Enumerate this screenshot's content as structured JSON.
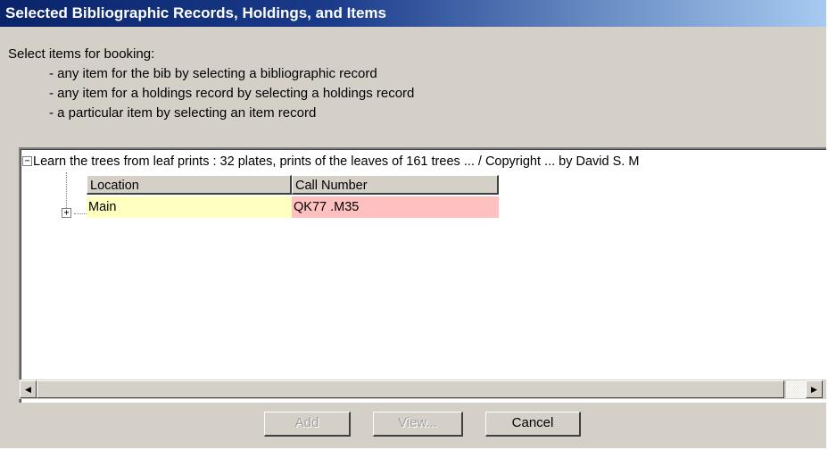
{
  "dialog": {
    "title": "Selected Bibliographic Records, Holdings, and Items"
  },
  "intro": {
    "heading": "Select items for booking:",
    "options": [
      "- any item for the bib by selecting a bibliographic record",
      "- any item for a holdings record by selecting a holdings record",
      "- a particular item by selecting an item record"
    ]
  },
  "tree": {
    "bib_record": "Learn the trees from leaf prints : 32 plates, prints of the leaves of 161 trees ... / Copyright ... by David S. M",
    "columns": [
      "Location",
      "Call Number"
    ],
    "holdings": [
      {
        "location": "Main",
        "call_number": "QK77 .M35"
      }
    ]
  },
  "buttons": {
    "add": "Add",
    "view": "View...",
    "cancel": "Cancel"
  },
  "colors": {
    "location_cell": "#ffffc0",
    "call_number_cell": "#ffc0c0"
  }
}
